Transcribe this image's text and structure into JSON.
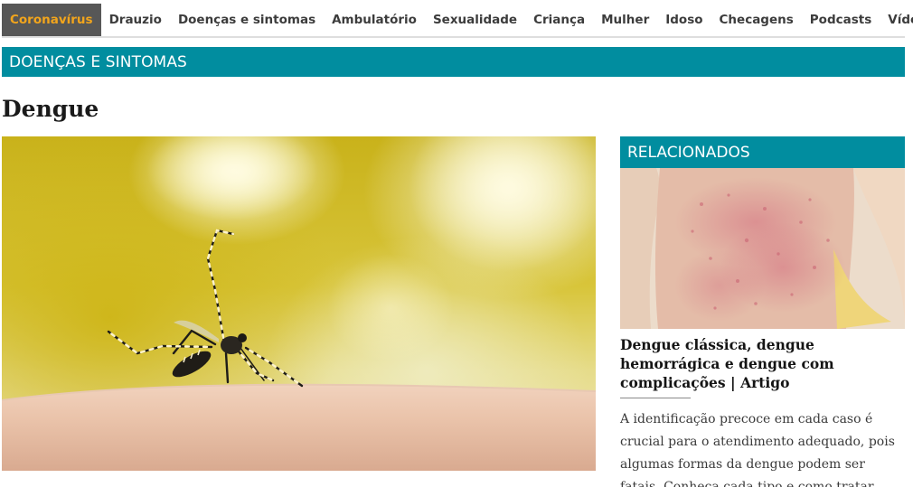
{
  "nav": {
    "items": [
      {
        "label": "Coronavírus"
      },
      {
        "label": "Drauzio"
      },
      {
        "label": "Doenças e sintomas"
      },
      {
        "label": "Ambulatório"
      },
      {
        "label": "Sexualidade"
      },
      {
        "label": "Criança"
      },
      {
        "label": "Mulher"
      },
      {
        "label": "Idoso"
      },
      {
        "label": "Checagens"
      },
      {
        "label": "Podcasts"
      },
      {
        "label": "Vídeos"
      }
    ]
  },
  "section": {
    "label": "DOENÇAS E SINTOMAS"
  },
  "article": {
    "title": "Dengue"
  },
  "sidebar": {
    "heading": "RELACIONADOS",
    "related": {
      "title": "Dengue clássica, dengue hemorrágica e dengue com complicações | Artigo",
      "description": "A identificação precoce em cada caso é crucial para o atendimento adequado, pois algumas formas da dengue podem ser fatais. Conheça cada tipo e como tratar."
    }
  },
  "colors": {
    "accent_teal": "#018d9f",
    "active_nav_bg": "#575757",
    "active_nav_text": "#f2a51c"
  }
}
